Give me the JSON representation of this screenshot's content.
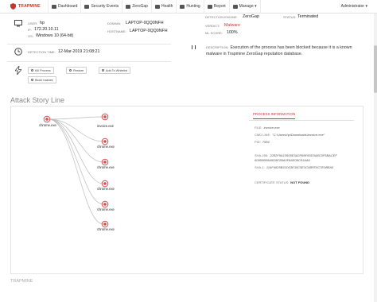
{
  "nav": {
    "brand": "TRAPMINE",
    "items": [
      {
        "label": "Dashboard",
        "icon": "dashboard-icon"
      },
      {
        "label": "Security Events",
        "icon": "bell-icon"
      },
      {
        "label": "ZeroGap",
        "icon": "cloud-icon"
      },
      {
        "label": "Health",
        "icon": "heart-icon"
      },
      {
        "label": "Hunting",
        "icon": "crosshair-icon"
      },
      {
        "label": "Report",
        "icon": "report-icon"
      },
      {
        "label": "Manage ▾",
        "icon": "gear-icon"
      }
    ],
    "user": "Administrator ▾"
  },
  "event": {
    "user_label": "USER:",
    "user_value": "hp",
    "ip_label": "IP:",
    "ip_value": "172.20.10.11",
    "os_label": "OS:",
    "os_value": "Windows 10 (64-bit)",
    "domain_label": "DOMAIN:",
    "domain_value": "LAPTOP-0QQ0NFH",
    "hostname_label": "HOSTNAME:",
    "hostname_value": "LAPTOP-0QQ0NFH",
    "detection_time_label": "DETECTION TIME:",
    "detection_time_value": "12-Mar-2019 21:08:21",
    "engine_label": "DETECTION ENGINE:",
    "engine_value": "ZeroGap",
    "status_label": "STATUS:",
    "status_value": "Terminated",
    "verdict_label": "VERDICT:",
    "verdict_value": "Malware",
    "score_label": "ML SCORE:",
    "score_value": "100%",
    "description_label": "DESCRIPTION:",
    "description_value": "Execution of the process has been blocked because it is a known malware in Trapmine ZeroGap reputation database."
  },
  "actions": {
    "kill": "Kill Process",
    "restore": "Restore",
    "whitelist": "Add To Whitelist",
    "block": "Block hashes"
  },
  "story": {
    "title": "Attack Story Line",
    "root": "chrome.exe",
    "children": [
      "invoice.exe",
      "chrome.exe",
      "chrome.exe",
      "chrome.exe",
      "chrome.exe",
      "chrome.exe"
    ]
  },
  "process_info": {
    "tab": "PROCESS INFORMATION",
    "file_label": "FILE:",
    "file_value": "invoice.exe",
    "cmd_label": "CMD LINE:",
    "cmd_value": "\"C:\\Users\\hp\\Downloads\\invoice.exe\"",
    "pid_label": "PID:",
    "pid_value": "7584",
    "sha256_label": "SHA-256:",
    "sha256_value": "2282F9A13605E3A2FB9F60D3A8C0F5BACEF 60950B09A5D9E2BA0FA6E08C81AA6",
    "sha1_label": "SHA-1:",
    "sha1_value": "114F4625B31D03E35C5E3C5BFE5C7E0B8A0",
    "cert_label": "CERTIFICATE STATUS:",
    "cert_value": "NOT FOUND"
  },
  "footer": "TRAPMINE",
  "colors": {
    "accent": "#c0392b",
    "node": "#d94c4c"
  }
}
